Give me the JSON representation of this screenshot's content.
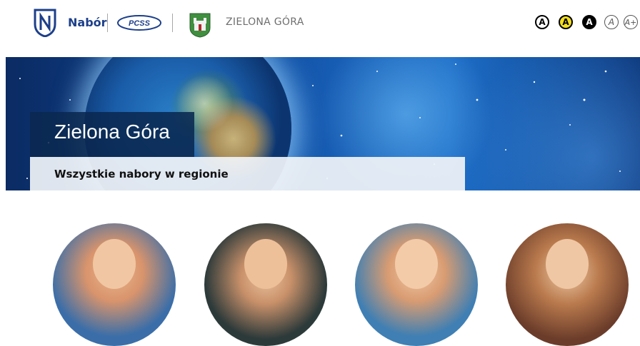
{
  "header": {
    "brand_name": "Nabór",
    "partner_logo_text": "PCSS",
    "city_name": "ZIELONA GÓRA",
    "contrast_buttons": [
      {
        "label": "A",
        "name": "contrast-default-button"
      },
      {
        "label": "A",
        "name": "contrast-yellow-button"
      },
      {
        "label": "A",
        "name": "contrast-black-button"
      },
      {
        "label": "A",
        "name": "font-size-normal-button"
      },
      {
        "label": "A+",
        "name": "font-size-larger-button"
      }
    ]
  },
  "banner": {
    "title": "Zielona Góra",
    "subtitle": "Wszystkie nabory w regionie"
  },
  "categories": [
    {
      "name": "category-nursery"
    },
    {
      "name": "category-preschool"
    },
    {
      "name": "category-primary-school"
    },
    {
      "name": "category-secondary-school"
    }
  ],
  "colors": {
    "brand": "#1d3f8a",
    "contrast_yellow": "#f3df1d",
    "title_box": "#0a2850",
    "subtitle_box": "#f0f3f8"
  }
}
